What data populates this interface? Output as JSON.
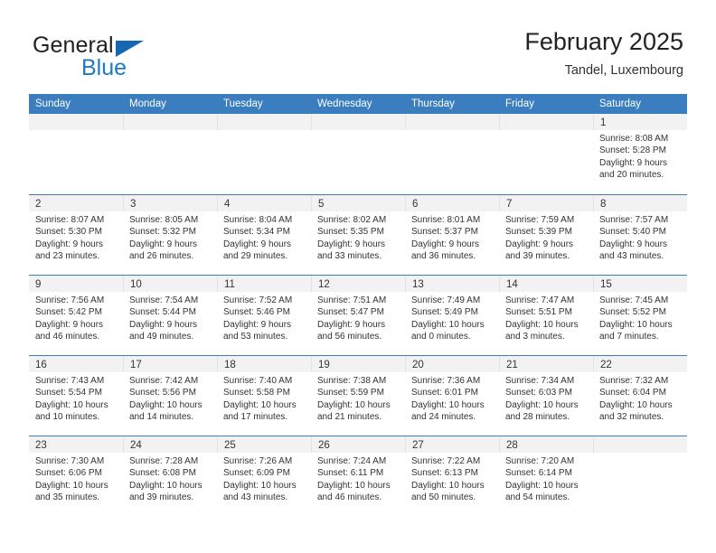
{
  "brand": {
    "name_part1": "General",
    "name_part2": "Blue",
    "triangle_color": "#1667b2",
    "blue_color": "#1f7ac4"
  },
  "header": {
    "title": "February 2025",
    "subtitle": "Tandel, Luxembourg"
  },
  "theme": {
    "header_blue": "#3a7ebf",
    "daynum_band": "#f2f2f2",
    "text": "#333333"
  },
  "calendar": {
    "weekdays": [
      "Sunday",
      "Monday",
      "Tuesday",
      "Wednesday",
      "Thursday",
      "Friday",
      "Saturday"
    ],
    "weeks": [
      [
        {
          "day": "",
          "lines": []
        },
        {
          "day": "",
          "lines": []
        },
        {
          "day": "",
          "lines": []
        },
        {
          "day": "",
          "lines": []
        },
        {
          "day": "",
          "lines": []
        },
        {
          "day": "",
          "lines": []
        },
        {
          "day": "1",
          "lines": [
            "Sunrise: 8:08 AM",
            "Sunset: 5:28 PM",
            "Daylight: 9 hours",
            "and 20 minutes."
          ]
        }
      ],
      [
        {
          "day": "2",
          "lines": [
            "Sunrise: 8:07 AM",
            "Sunset: 5:30 PM",
            "Daylight: 9 hours",
            "and 23 minutes."
          ]
        },
        {
          "day": "3",
          "lines": [
            "Sunrise: 8:05 AM",
            "Sunset: 5:32 PM",
            "Daylight: 9 hours",
            "and 26 minutes."
          ]
        },
        {
          "day": "4",
          "lines": [
            "Sunrise: 8:04 AM",
            "Sunset: 5:34 PM",
            "Daylight: 9 hours",
            "and 29 minutes."
          ]
        },
        {
          "day": "5",
          "lines": [
            "Sunrise: 8:02 AM",
            "Sunset: 5:35 PM",
            "Daylight: 9 hours",
            "and 33 minutes."
          ]
        },
        {
          "day": "6",
          "lines": [
            "Sunrise: 8:01 AM",
            "Sunset: 5:37 PM",
            "Daylight: 9 hours",
            "and 36 minutes."
          ]
        },
        {
          "day": "7",
          "lines": [
            "Sunrise: 7:59 AM",
            "Sunset: 5:39 PM",
            "Daylight: 9 hours",
            "and 39 minutes."
          ]
        },
        {
          "day": "8",
          "lines": [
            "Sunrise: 7:57 AM",
            "Sunset: 5:40 PM",
            "Daylight: 9 hours",
            "and 43 minutes."
          ]
        }
      ],
      [
        {
          "day": "9",
          "lines": [
            "Sunrise: 7:56 AM",
            "Sunset: 5:42 PM",
            "Daylight: 9 hours",
            "and 46 minutes."
          ]
        },
        {
          "day": "10",
          "lines": [
            "Sunrise: 7:54 AM",
            "Sunset: 5:44 PM",
            "Daylight: 9 hours",
            "and 49 minutes."
          ]
        },
        {
          "day": "11",
          "lines": [
            "Sunrise: 7:52 AM",
            "Sunset: 5:46 PM",
            "Daylight: 9 hours",
            "and 53 minutes."
          ]
        },
        {
          "day": "12",
          "lines": [
            "Sunrise: 7:51 AM",
            "Sunset: 5:47 PM",
            "Daylight: 9 hours",
            "and 56 minutes."
          ]
        },
        {
          "day": "13",
          "lines": [
            "Sunrise: 7:49 AM",
            "Sunset: 5:49 PM",
            "Daylight: 10 hours",
            "and 0 minutes."
          ]
        },
        {
          "day": "14",
          "lines": [
            "Sunrise: 7:47 AM",
            "Sunset: 5:51 PM",
            "Daylight: 10 hours",
            "and 3 minutes."
          ]
        },
        {
          "day": "15",
          "lines": [
            "Sunrise: 7:45 AM",
            "Sunset: 5:52 PM",
            "Daylight: 10 hours",
            "and 7 minutes."
          ]
        }
      ],
      [
        {
          "day": "16",
          "lines": [
            "Sunrise: 7:43 AM",
            "Sunset: 5:54 PM",
            "Daylight: 10 hours",
            "and 10 minutes."
          ]
        },
        {
          "day": "17",
          "lines": [
            "Sunrise: 7:42 AM",
            "Sunset: 5:56 PM",
            "Daylight: 10 hours",
            "and 14 minutes."
          ]
        },
        {
          "day": "18",
          "lines": [
            "Sunrise: 7:40 AM",
            "Sunset: 5:58 PM",
            "Daylight: 10 hours",
            "and 17 minutes."
          ]
        },
        {
          "day": "19",
          "lines": [
            "Sunrise: 7:38 AM",
            "Sunset: 5:59 PM",
            "Daylight: 10 hours",
            "and 21 minutes."
          ]
        },
        {
          "day": "20",
          "lines": [
            "Sunrise: 7:36 AM",
            "Sunset: 6:01 PM",
            "Daylight: 10 hours",
            "and 24 minutes."
          ]
        },
        {
          "day": "21",
          "lines": [
            "Sunrise: 7:34 AM",
            "Sunset: 6:03 PM",
            "Daylight: 10 hours",
            "and 28 minutes."
          ]
        },
        {
          "day": "22",
          "lines": [
            "Sunrise: 7:32 AM",
            "Sunset: 6:04 PM",
            "Daylight: 10 hours",
            "and 32 minutes."
          ]
        }
      ],
      [
        {
          "day": "23",
          "lines": [
            "Sunrise: 7:30 AM",
            "Sunset: 6:06 PM",
            "Daylight: 10 hours",
            "and 35 minutes."
          ]
        },
        {
          "day": "24",
          "lines": [
            "Sunrise: 7:28 AM",
            "Sunset: 6:08 PM",
            "Daylight: 10 hours",
            "and 39 minutes."
          ]
        },
        {
          "day": "25",
          "lines": [
            "Sunrise: 7:26 AM",
            "Sunset: 6:09 PM",
            "Daylight: 10 hours",
            "and 43 minutes."
          ]
        },
        {
          "day": "26",
          "lines": [
            "Sunrise: 7:24 AM",
            "Sunset: 6:11 PM",
            "Daylight: 10 hours",
            "and 46 minutes."
          ]
        },
        {
          "day": "27",
          "lines": [
            "Sunrise: 7:22 AM",
            "Sunset: 6:13 PM",
            "Daylight: 10 hours",
            "and 50 minutes."
          ]
        },
        {
          "day": "28",
          "lines": [
            "Sunrise: 7:20 AM",
            "Sunset: 6:14 PM",
            "Daylight: 10 hours",
            "and 54 minutes."
          ]
        },
        {
          "day": "",
          "lines": []
        }
      ]
    ]
  }
}
